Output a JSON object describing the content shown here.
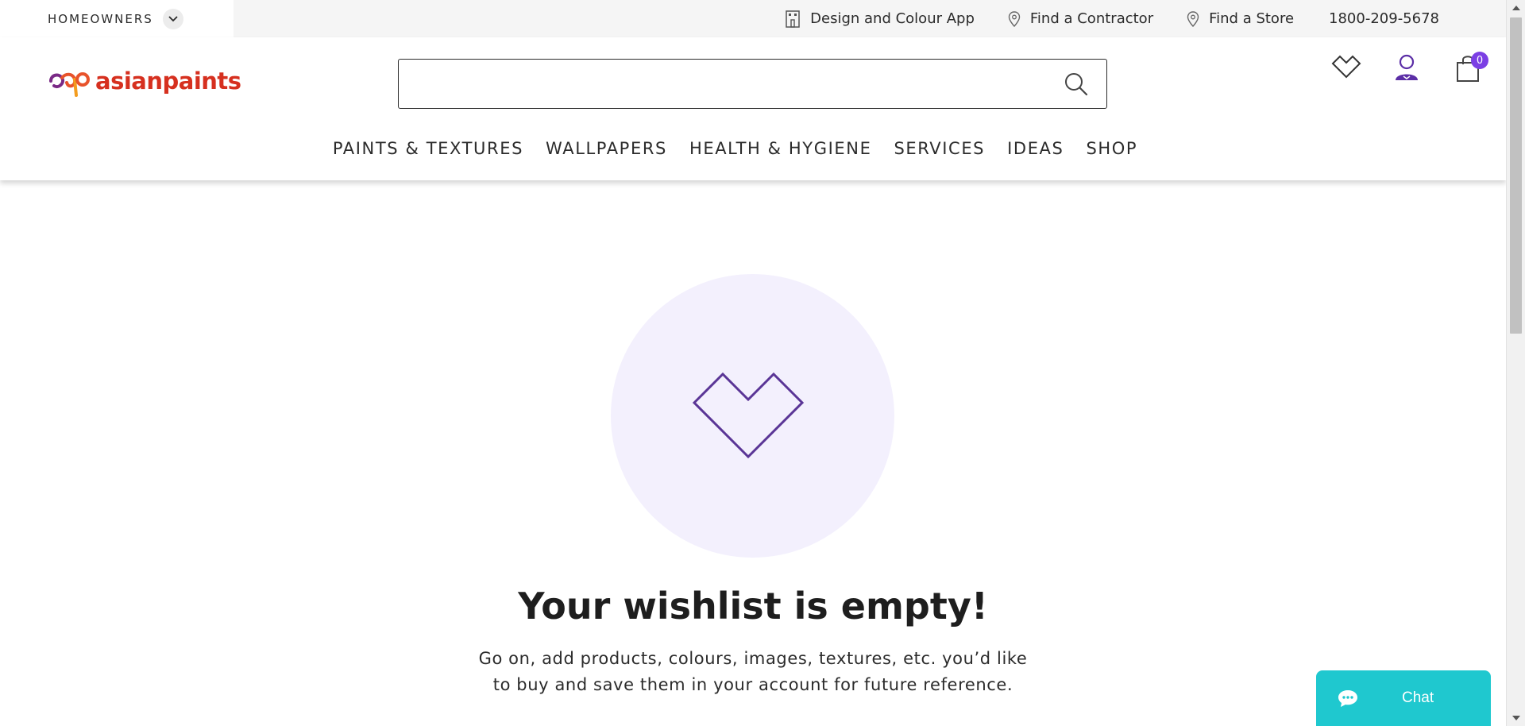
{
  "topbar": {
    "segment_label": "HOMEOWNERS",
    "links": [
      {
        "label": "Design and Colour App",
        "icon": "building-icon"
      },
      {
        "label": "Find a Contractor",
        "icon": "location-pin-icon"
      },
      {
        "label": "Find a Store",
        "icon": "location-pin-icon"
      }
    ],
    "phone": "1800-209-5678"
  },
  "header": {
    "logo_text": "asianpaints",
    "search_placeholder": "",
    "cart_count": "0",
    "nav": [
      "PAINTS & TEXTURES",
      "WALLPAPERS",
      "HEALTH & HYGIENE",
      "SERVICES",
      "IDEAS",
      "SHOP"
    ]
  },
  "main": {
    "title": "Your wishlist is empty!",
    "desc_line1": "Go on, add products, colours, images, textures, etc. you’d like",
    "desc_line2": "to buy and save them in your account for future reference."
  },
  "chat": {
    "label": "Chat"
  },
  "colors": {
    "brand_red": "#d6301f",
    "accent_purple": "#7b3fe4",
    "chat_teal": "#1fc8cf",
    "circle_bg": "#f3f0fd"
  }
}
